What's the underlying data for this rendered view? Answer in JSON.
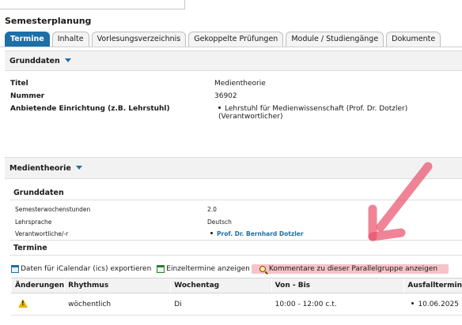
{
  "page": {
    "title": "Semesterplanung"
  },
  "tabs": [
    {
      "label": "Termine",
      "active": true
    },
    {
      "label": "Inhalte"
    },
    {
      "label": "Vorlesungsverzeichnis"
    },
    {
      "label": "Gekoppelte Prüfungen"
    },
    {
      "label": "Module / Studiengänge"
    },
    {
      "label": "Dokumente"
    }
  ],
  "grunddaten": {
    "header": "Grunddaten",
    "rows": [
      {
        "label": "Titel",
        "value": "Medientheorie"
      },
      {
        "label": "Nummer",
        "value": "36902"
      },
      {
        "label": "Anbietende Einrichtung (z.B. Lehrstuhl)",
        "value": "Lehrstuhl für Medienwissenschaft (Prof. Dr. Dotzler) (Verantwortlicher)"
      }
    ]
  },
  "parallelgruppe": {
    "header": "Medientheorie",
    "sub_header": "Grunddaten",
    "rows": [
      {
        "label": "Semesterwochenstunden",
        "value": "2.0"
      },
      {
        "label": "Lehrsprache",
        "value": "Deutsch"
      },
      {
        "label": "Verantwortliche/-r",
        "value": "Prof. Dr. Bernhard Dotzler"
      }
    ],
    "termine_header": "Termine"
  },
  "actions": {
    "ical": "Daten für iCalendar (ics) exportieren",
    "einzeltermine": "Einzeltermine anzeigen",
    "kommentare": "Kommentare zu dieser Parallelgruppe anzeigen"
  },
  "table": {
    "headers": [
      "Änderungen",
      "Rhythmus",
      "Wochentag",
      "Von - Bis",
      "Ausfalltermin"
    ],
    "rows": [
      {
        "aenderung_icon": "warning-icon",
        "rhythmus": "wöchentlich",
        "wochentag": "Di",
        "von_bis": "10:00 - 12:00 c.t.",
        "ausfalltermin": "10.06.2025"
      }
    ]
  },
  "colors": {
    "accent": "#1d6fa8",
    "highlight": "#f6c3c8",
    "annotation_arrow": "#e8506a",
    "warning": "#e8b400"
  }
}
